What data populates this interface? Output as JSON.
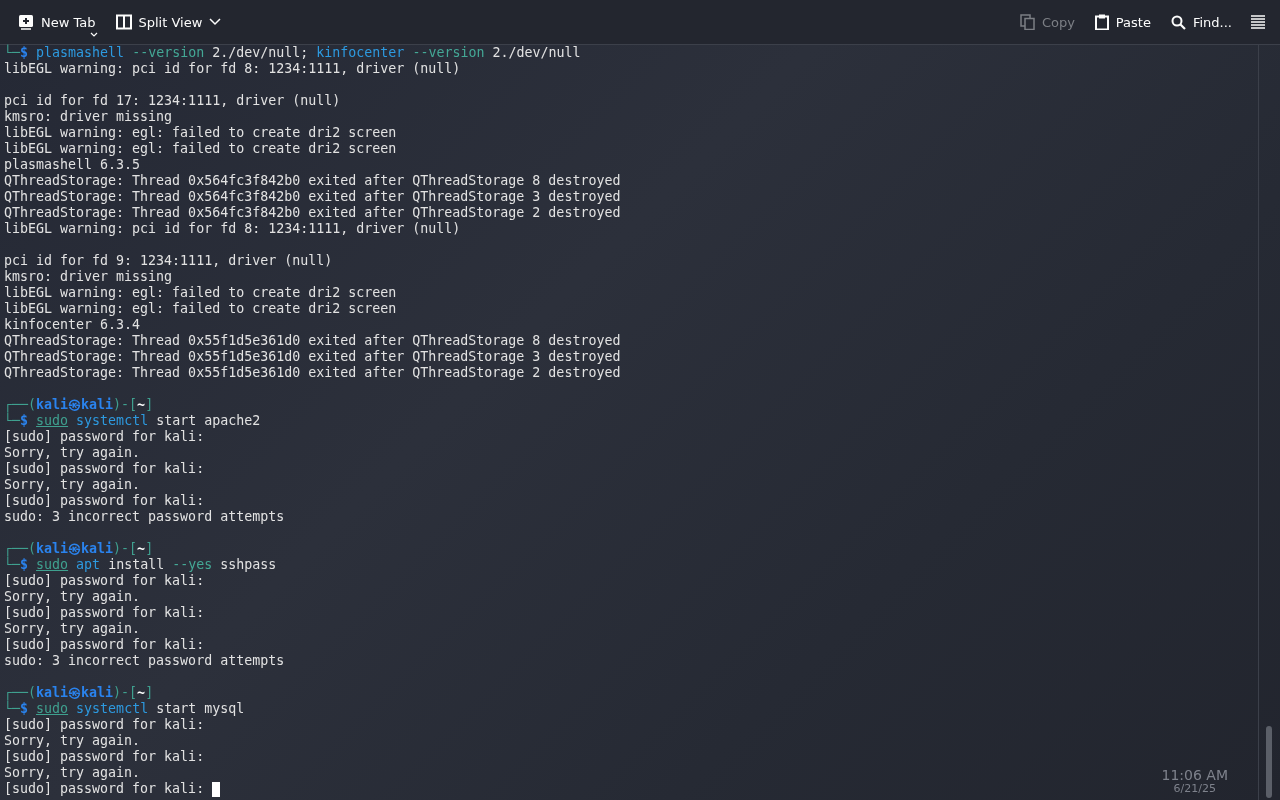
{
  "toolbar": {
    "left": [
      {
        "kind": "new-tab",
        "label": "New Tab",
        "disabled": false
      },
      {
        "kind": "split-view",
        "label": "Split View",
        "disabled": false
      }
    ],
    "right": [
      {
        "kind": "copy",
        "label": "Copy",
        "disabled": true
      },
      {
        "kind": "paste",
        "label": "Paste",
        "disabled": false
      },
      {
        "kind": "find",
        "label": "Find...",
        "disabled": false
      }
    ]
  },
  "terminal": {
    "lines": [
      {
        "kind": "command",
        "prefix": "└─",
        "prompt": "$",
        "segments": [
          {
            "kind": "cmd",
            "text": "plasmashell"
          },
          {
            "kind": "flag",
            "text": "--version"
          },
          {
            "kind": "arg",
            "text": "2./dev/null;"
          },
          {
            "kind": "cmd",
            "text": "kinfocenter"
          },
          {
            "kind": "flag",
            "text": "--version"
          },
          {
            "kind": "arg",
            "text": "2./dev/null"
          }
        ]
      },
      {
        "kind": "output",
        "text": "libEGL warning: pci id for fd 8: 1234:1111, driver (null)"
      },
      {
        "kind": "blank"
      },
      {
        "kind": "output",
        "text": "pci id for fd 17: 1234:1111, driver (null)"
      },
      {
        "kind": "output",
        "text": "kmsro: driver missing"
      },
      {
        "kind": "output",
        "text": "libEGL warning: egl: failed to create dri2 screen"
      },
      {
        "kind": "output",
        "text": "libEGL warning: egl: failed to create dri2 screen"
      },
      {
        "kind": "output",
        "text": "plasmashell 6.3.5"
      },
      {
        "kind": "output",
        "text": "QThreadStorage: Thread 0x564fc3f842b0 exited after QThreadStorage 8 destroyed"
      },
      {
        "kind": "output",
        "text": "QThreadStorage: Thread 0x564fc3f842b0 exited after QThreadStorage 3 destroyed"
      },
      {
        "kind": "output",
        "text": "QThreadStorage: Thread 0x564fc3f842b0 exited after QThreadStorage 2 destroyed"
      },
      {
        "kind": "output",
        "text": "libEGL warning: pci id for fd 8: 1234:1111, driver (null)"
      },
      {
        "kind": "blank"
      },
      {
        "kind": "output",
        "text": "pci id for fd 9: 1234:1111, driver (null)"
      },
      {
        "kind": "output",
        "text": "kmsro: driver missing"
      },
      {
        "kind": "output",
        "text": "libEGL warning: egl: failed to create dri2 screen"
      },
      {
        "kind": "output",
        "text": "libEGL warning: egl: failed to create dri2 screen"
      },
      {
        "kind": "output",
        "text": "kinfocenter 6.3.4"
      },
      {
        "kind": "output",
        "text": "QThreadStorage: Thread 0x55f1d5e361d0 exited after QThreadStorage 8 destroyed"
      },
      {
        "kind": "output",
        "text": "QThreadStorage: Thread 0x55f1d5e361d0 exited after QThreadStorage 3 destroyed"
      },
      {
        "kind": "output",
        "text": "QThreadStorage: Thread 0x55f1d5e361d0 exited after QThreadStorage 2 destroyed"
      },
      {
        "kind": "blank"
      },
      {
        "kind": "head",
        "parts": [
          {
            "kind": "frame",
            "text": "┌──("
          },
          {
            "kind": "user",
            "text": "kali㉿kali"
          },
          {
            "kind": "frame",
            "text": ")-["
          },
          {
            "kind": "dir",
            "text": "~"
          },
          {
            "kind": "frame",
            "text": "]"
          }
        ]
      },
      {
        "kind": "command",
        "prefix": "└─",
        "prompt": "$",
        "segments": [
          {
            "kind": "sudo",
            "text": "sudo"
          },
          {
            "kind": "cmd",
            "text": "systemctl"
          },
          {
            "kind": "arg",
            "text": "start"
          },
          {
            "kind": "arg",
            "text": "apache2"
          }
        ]
      },
      {
        "kind": "output",
        "text": "[sudo] password for kali:"
      },
      {
        "kind": "output",
        "text": "Sorry, try again."
      },
      {
        "kind": "output",
        "text": "[sudo] password for kali:"
      },
      {
        "kind": "output",
        "text": "Sorry, try again."
      },
      {
        "kind": "output",
        "text": "[sudo] password for kali:"
      },
      {
        "kind": "output",
        "text": "sudo: 3 incorrect password attempts"
      },
      {
        "kind": "blank"
      },
      {
        "kind": "head",
        "parts": [
          {
            "kind": "frame",
            "text": "┌──("
          },
          {
            "kind": "user",
            "text": "kali㉿kali"
          },
          {
            "kind": "frame",
            "text": ")-["
          },
          {
            "kind": "dir",
            "text": "~"
          },
          {
            "kind": "frame",
            "text": "]"
          }
        ]
      },
      {
        "kind": "command",
        "prefix": "└─",
        "prompt": "$",
        "segments": [
          {
            "kind": "sudo",
            "text": "sudo"
          },
          {
            "kind": "cmd",
            "text": "apt"
          },
          {
            "kind": "arg",
            "text": "install"
          },
          {
            "kind": "flag",
            "text": "--yes"
          },
          {
            "kind": "arg",
            "text": "sshpass"
          }
        ]
      },
      {
        "kind": "output",
        "text": "[sudo] password for kali:"
      },
      {
        "kind": "output",
        "text": "Sorry, try again."
      },
      {
        "kind": "output",
        "text": "[sudo] password for kali:"
      },
      {
        "kind": "output",
        "text": "Sorry, try again."
      },
      {
        "kind": "output",
        "text": "[sudo] password for kali:"
      },
      {
        "kind": "output",
        "text": "sudo: 3 incorrect password attempts"
      },
      {
        "kind": "blank"
      },
      {
        "kind": "head",
        "parts": [
          {
            "kind": "frame",
            "text": "┌──("
          },
          {
            "kind": "user",
            "text": "kali㉿kali"
          },
          {
            "kind": "frame",
            "text": ")-["
          },
          {
            "kind": "dir",
            "text": "~"
          },
          {
            "kind": "frame",
            "text": "]"
          }
        ]
      },
      {
        "kind": "command",
        "prefix": "└─",
        "prompt": "$",
        "segments": [
          {
            "kind": "sudo",
            "text": "sudo"
          },
          {
            "kind": "cmd",
            "text": "systemctl"
          },
          {
            "kind": "arg",
            "text": "start"
          },
          {
            "kind": "arg",
            "text": "mysql"
          }
        ]
      },
      {
        "kind": "output",
        "text": "[sudo] password for kali:"
      },
      {
        "kind": "output",
        "text": "Sorry, try again."
      },
      {
        "kind": "output",
        "text": "[sudo] password for kali:"
      },
      {
        "kind": "output",
        "text": "Sorry, try again."
      },
      {
        "kind": "output",
        "text": "[sudo] password for kali:",
        "cursor": true
      }
    ]
  },
  "desktop_behind": {
    "clock": "11:06 AM",
    "date": "6/21/25"
  }
}
